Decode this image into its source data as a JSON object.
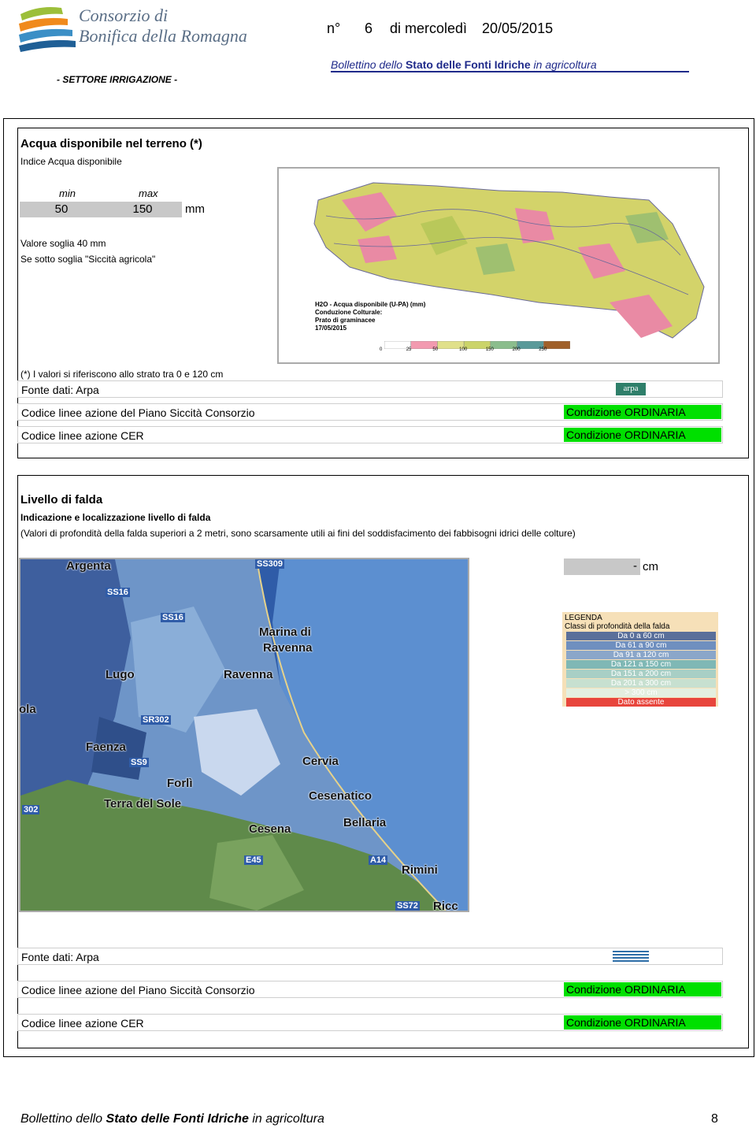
{
  "logo": {
    "line1": "Consorzio di",
    "line2": "Bonifica della Romagna"
  },
  "header": {
    "n_label": "n°",
    "number": "6",
    "day_text": "di mercoledì",
    "date": "20/05/2015",
    "bulletin_part1": "Bollettino dello ",
    "bulletin_part2": "Stato delle Fonti Idriche",
    "bulletin_part3": " in agricoltura",
    "sector": "- SETTORE IRRIGAZIONE -"
  },
  "section1": {
    "title": "Acqua disponibile nel terreno (*)",
    "subtitle": "Indice Acqua disponibile",
    "min_label": "min",
    "max_label": "max",
    "min_value": "50",
    "max_value": "150",
    "unit": "mm",
    "threshold": "Valore soglia 40 mm",
    "threshold_note": "Se sotto soglia \"Siccità agricola\"",
    "footnote": "(*) I valori si riferiscono allo strato tra 0 e 120 cm",
    "source": "Fonte dati: Arpa",
    "source_logo": "arpa",
    "row1_label": "Codice linee azione del Piano Siccità Consorzio",
    "row1_value": "Condizione ORDINARIA",
    "row2_label": "Codice linee azione CER",
    "row2_value": "Condizione ORDINARIA",
    "map": {
      "title1": "H2O - Acqua disponibile (U-PA) (mm)",
      "title2": "Conduzione Colturale:",
      "title3": "Prato di graminacee",
      "title4": "17/05/2015",
      "scale_labels": [
        "0",
        "25",
        "50",
        "100",
        "150",
        "200",
        "250"
      ],
      "scale_colors": [
        "#ffffff",
        "#f29ab0",
        "#e0e08a",
        "#cbd46a",
        "#8bbd8d",
        "#5a9a9a",
        "#a0602a"
      ]
    }
  },
  "section2": {
    "title": "Livello di falda",
    "subtitle": "Indicazione e localizzazione livello di falda",
    "note": "(Valori di profondità della falda superiori a 2 metri, sono scarsamente utili ai fini del soddisfacimento dei fabbisogni idrici delle colture)",
    "value": "-",
    "unit": "cm",
    "legend_title": "LEGENDA",
    "legend_subtitle": "Classi di profondità della falda",
    "legend_items": [
      {
        "label": "Da 0 a 60 cm",
        "color": "#5a6f9a"
      },
      {
        "label": "Da 61 a 90 cm",
        "color": "#6f8fbf"
      },
      {
        "label": "Da 91 a 120 cm",
        "color": "#8aa6c9"
      },
      {
        "label": "Da 121 a 150 cm",
        "color": "#7fb8b5"
      },
      {
        "label": "Da 151 a 200 cm",
        "color": "#a8cfc5"
      },
      {
        "label": "Da 201 a 300 cm",
        "color": "#c7e0d0"
      },
      {
        "label": "> 300 cm",
        "color": "#e4efe0"
      },
      {
        "label": "Dato assente",
        "color": "#e8453c"
      }
    ],
    "map_labels": [
      "Argenta",
      "SS309",
      "SS16",
      "SS16",
      "Marina di",
      "Ravenna",
      "Lugo",
      "Ravenna",
      "ola",
      "SR302",
      "Faenza",
      "SS9",
      "Cervia",
      "Forlì",
      "302",
      "Terra del Sole",
      "Cesenatico",
      "Cesena",
      "Bellaria",
      "E45",
      "A14",
      "Rimini",
      "SS72",
      "Ricc"
    ],
    "source": "Fonte dati: Arpa",
    "row1_label": "Codice linee azione del Piano Siccità Consorzio",
    "row1_value": "Condizione ORDINARIA",
    "row2_label": "Codice linee azione CER",
    "row2_value": "Condizione ORDINARIA"
  },
  "footer": {
    "part1": "Bollettino dello ",
    "part2": "Stato delle Fonti Idriche",
    "part3": " in agricoltura",
    "page": "8"
  }
}
